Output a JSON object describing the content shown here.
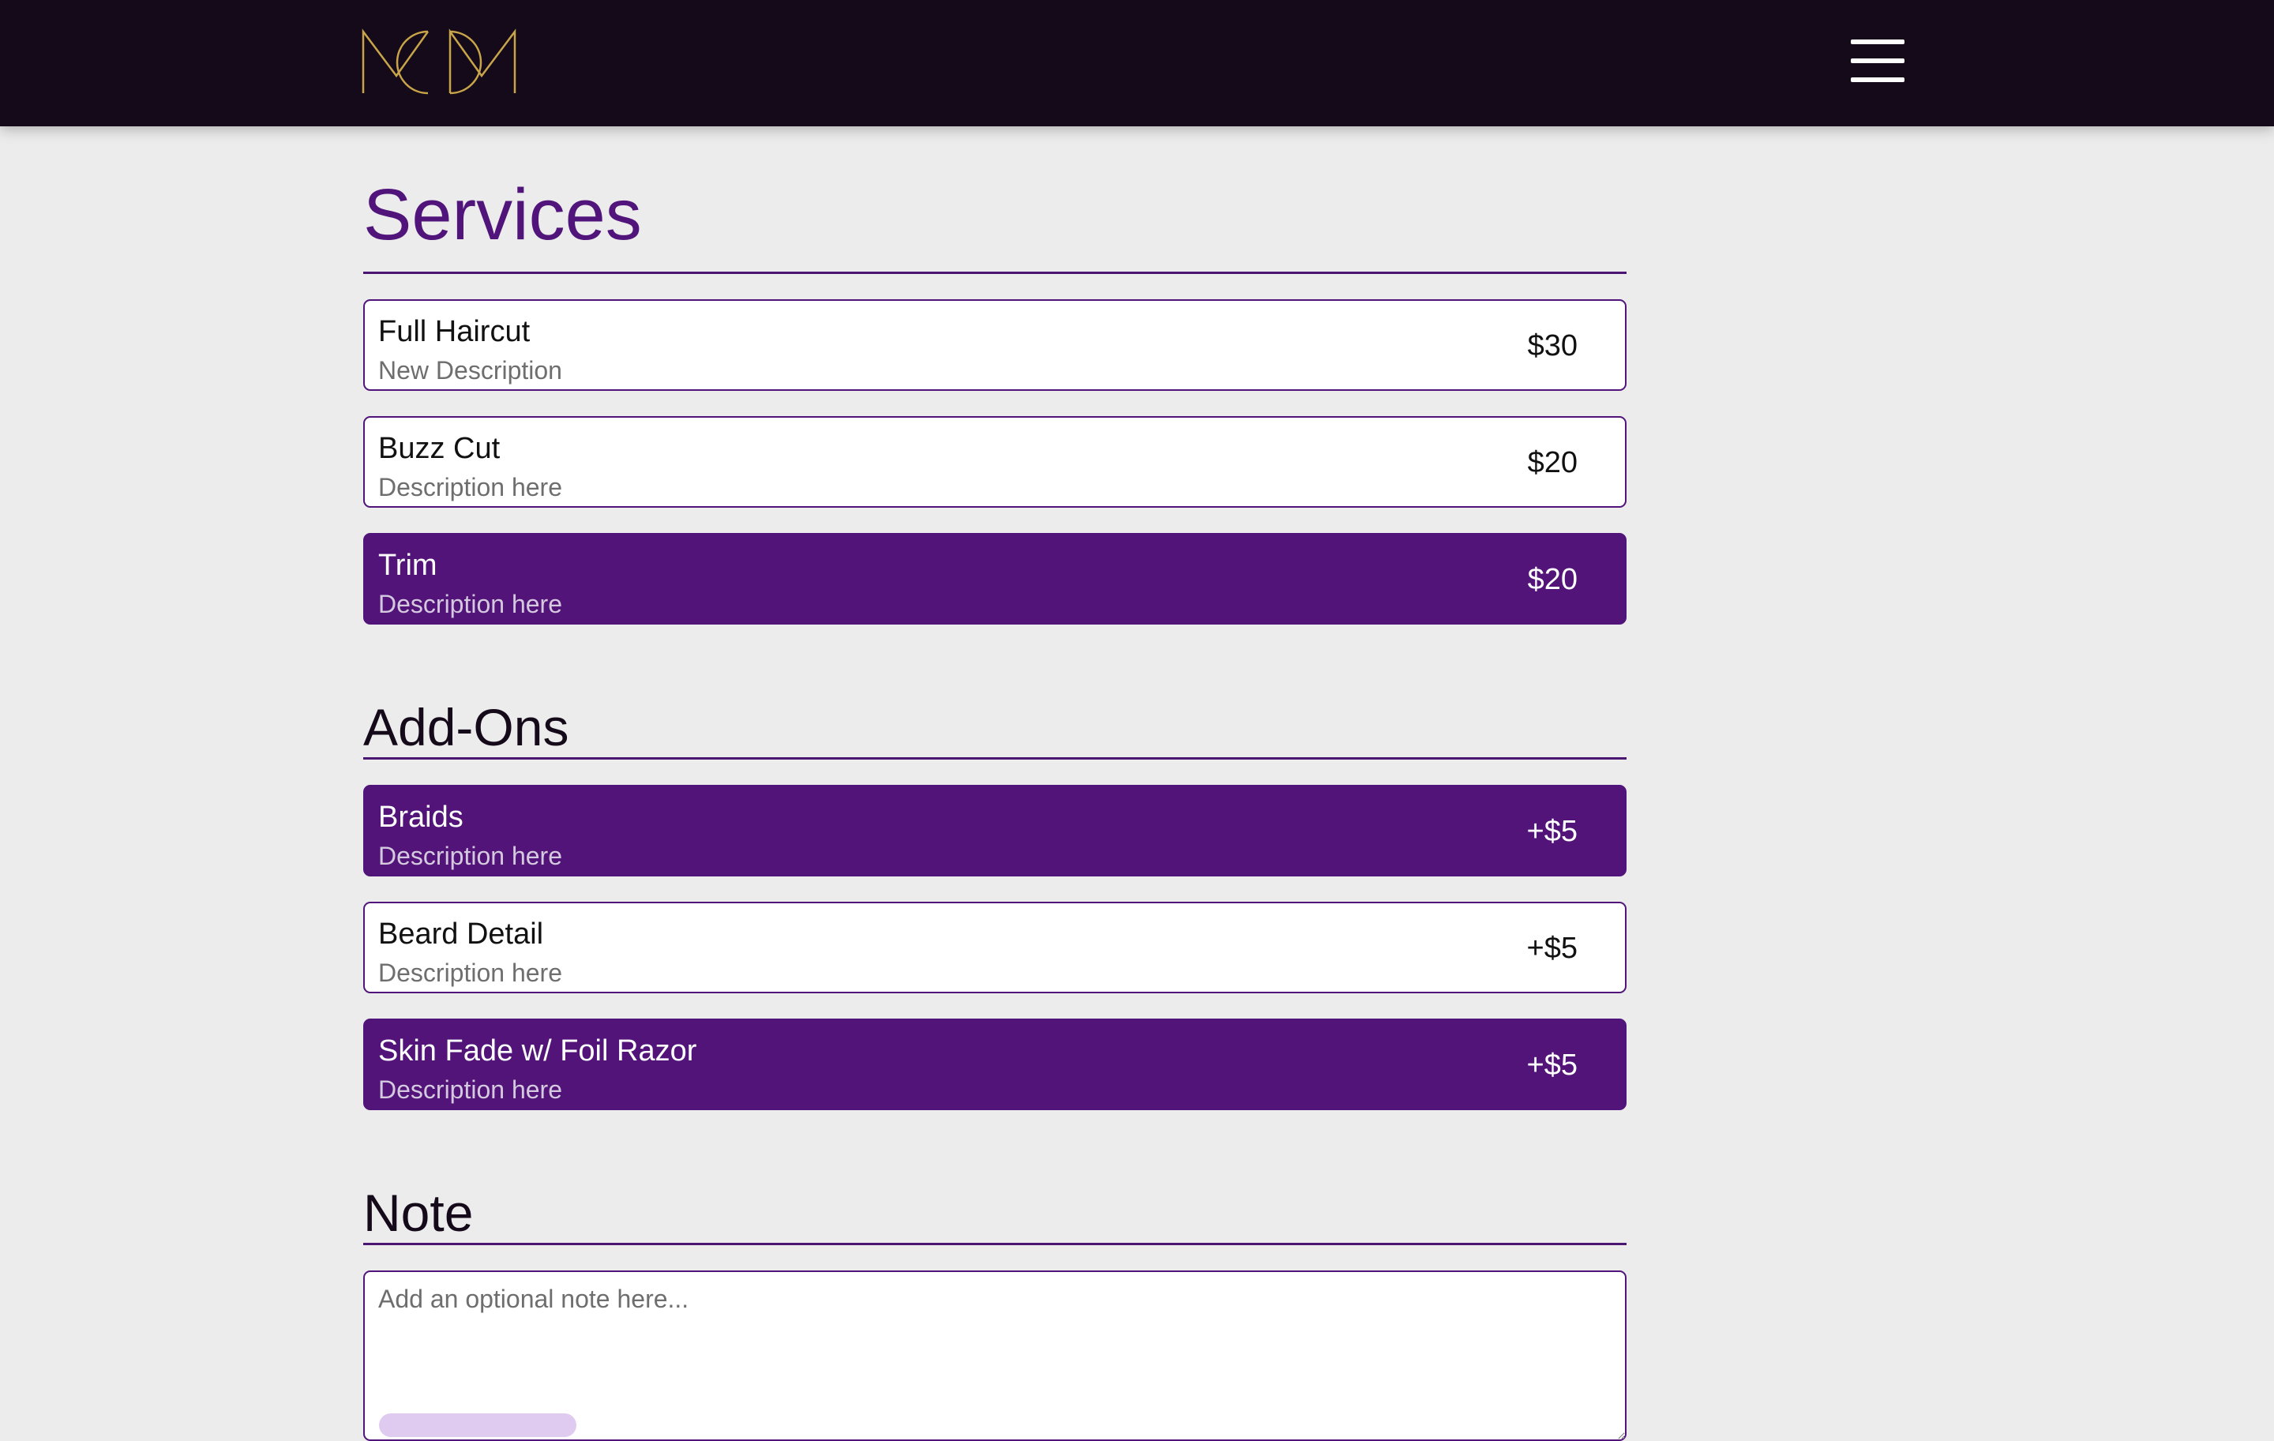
{
  "header": {
    "logo_text": "MCM",
    "menu_icon": "hamburger-menu-icon",
    "colors": {
      "background": "#150a19",
      "logo": "#c9a54a"
    }
  },
  "services": {
    "title": "Services",
    "items": [
      {
        "name": "Full Haircut",
        "description": "New Description",
        "price": "$30",
        "selected": false
      },
      {
        "name": "Buzz Cut",
        "description": "Description here",
        "price": "$20",
        "selected": false
      },
      {
        "name": "Trim",
        "description": "Description here",
        "price": "$20",
        "selected": true
      }
    ]
  },
  "addons": {
    "title": "Add-Ons",
    "items": [
      {
        "name": "Braids",
        "description": "Description here",
        "price": "+$5",
        "selected": true
      },
      {
        "name": "Beard Detail",
        "description": "Description here",
        "price": "+$5",
        "selected": false
      },
      {
        "name": "Skin Fade w/ Foil Razor",
        "description": "Description here",
        "price": "+$5",
        "selected": true
      }
    ]
  },
  "note": {
    "title": "Note",
    "placeholder": "Add an optional note here...",
    "value": ""
  },
  "colors": {
    "accent": "#521478",
    "page_background": "#ececec",
    "card_background": "#ffffff"
  }
}
